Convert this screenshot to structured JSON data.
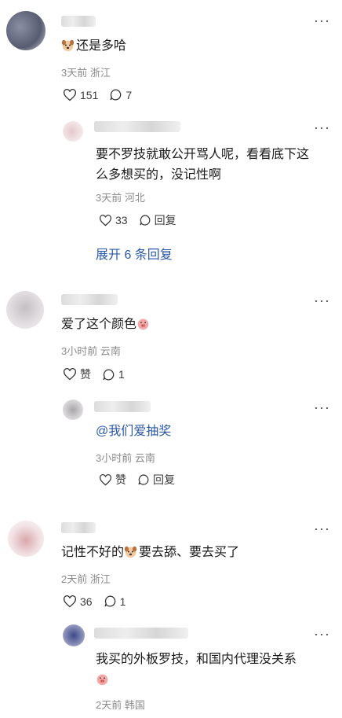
{
  "comments": [
    {
      "text": "还是多哈",
      "emoji": "dog-face-emoji",
      "meta_time": "3天前",
      "meta_loc": "浙江",
      "likes": "151",
      "replies": "7",
      "reply": {
        "text_line1": "要不罗技就敢公开骂人呢，看看底下这",
        "text_line2": "么多想买的，没记性啊",
        "meta_time": "3天前",
        "meta_loc": "河北",
        "likes": "33",
        "reply_label": "回复"
      },
      "expand_label": "展开 6 条回复"
    },
    {
      "text": "爱了这个颜色",
      "emoji": "pig-face-emoji",
      "meta_time": "3小时前",
      "meta_loc": "云南",
      "like_label": "赞",
      "replies": "1",
      "reply": {
        "text": "@我们爱抽奖",
        "meta_time": "3小时前",
        "meta_loc": "云南",
        "like_label": "赞",
        "reply_label": "回复"
      }
    },
    {
      "text_before": "记性不好的",
      "emoji": "dog-face-emoji",
      "text_after": "要去舔、要去买了",
      "meta_time": "2天前",
      "meta_loc": "浙江",
      "likes": "36",
      "replies": "1",
      "reply": {
        "text": "我买的外板罗技，和国内代理没关系",
        "emoji": "pig-face-emoji",
        "meta_time": "2天前",
        "meta_loc": "韩国"
      }
    }
  ],
  "more_icon": "···",
  "colors": {
    "link": "#2c58a9",
    "meta": "#8a8a8a",
    "text": "#1a1a1a"
  }
}
